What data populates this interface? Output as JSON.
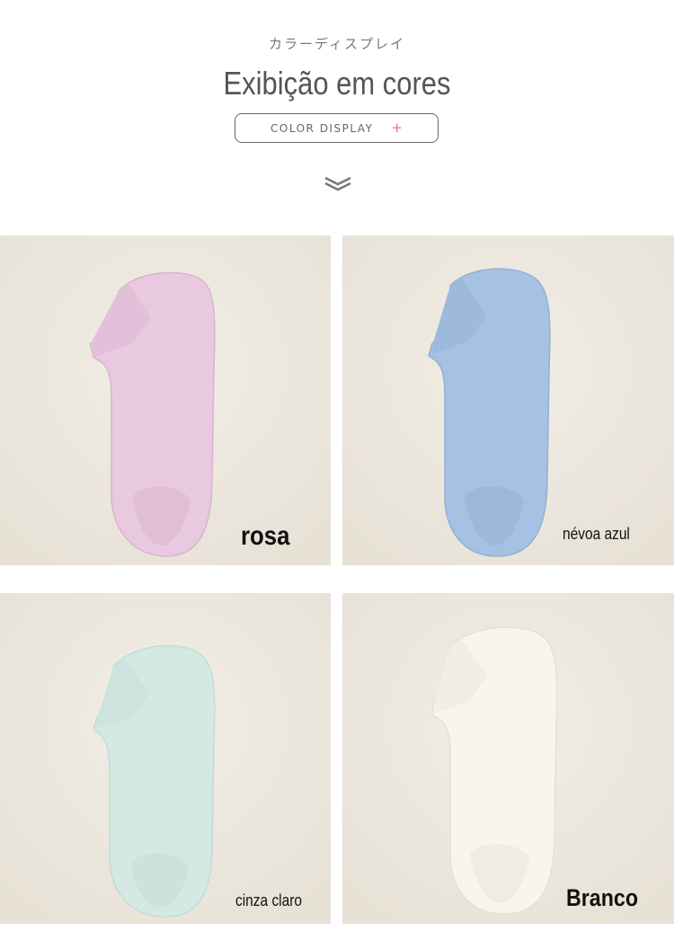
{
  "header": {
    "subtitle_jp": "カラーディスプレイ",
    "title": "Exibição em cores",
    "pill_label": "COLOR DISPLAY",
    "pill_plus": "+",
    "chevron_icon": "double-chevron-down-icon"
  },
  "colors": [
    {
      "label": "rosa",
      "sock": "#e8c9e0",
      "background": "#ede8df"
    },
    {
      "label": "névoa azul",
      "sock": "#a6c1e2",
      "background": "#ede8df"
    },
    {
      "label": "cinza claro",
      "sock": "#d5e9e4",
      "background": "#ede8df"
    },
    {
      "label": "Branco",
      "sock": "#f8f5ec",
      "background": "#ede8df"
    }
  ],
  "accent": "#e6736c"
}
